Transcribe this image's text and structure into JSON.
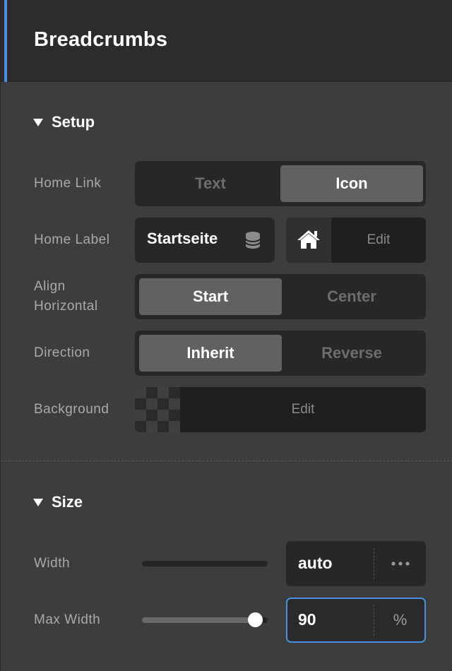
{
  "header": {
    "title": "Breadcrumbs"
  },
  "setup": {
    "section_title": "Setup",
    "home_link": {
      "label": "Home Link",
      "options": [
        "Text",
        "Icon"
      ],
      "selected": "Icon"
    },
    "home_label": {
      "label": "Home Label",
      "value": "Startseite",
      "icon": "home-icon",
      "edit_label": "Edit"
    },
    "align_horizontal": {
      "label_line1": "Align",
      "label_line2": "Horizontal",
      "options": [
        "Start",
        "Center"
      ],
      "selected": "Start"
    },
    "direction": {
      "label": "Direction",
      "options": [
        "Inherit",
        "Reverse"
      ],
      "selected": "Inherit"
    },
    "background": {
      "label": "Background",
      "edit_label": "Edit"
    }
  },
  "size": {
    "section_title": "Size",
    "width": {
      "label": "Width",
      "value": "auto",
      "unit_icon": "more-dots-icon",
      "slider_percent": 0
    },
    "max_width": {
      "label": "Max Width",
      "value": "90",
      "unit": "%",
      "slider_percent": 90
    }
  },
  "colors": {
    "accent": "#4a90e2",
    "active_segment": "#616161",
    "panel_bg": "#3d3d3d",
    "header_bg": "#2c2c2c"
  }
}
